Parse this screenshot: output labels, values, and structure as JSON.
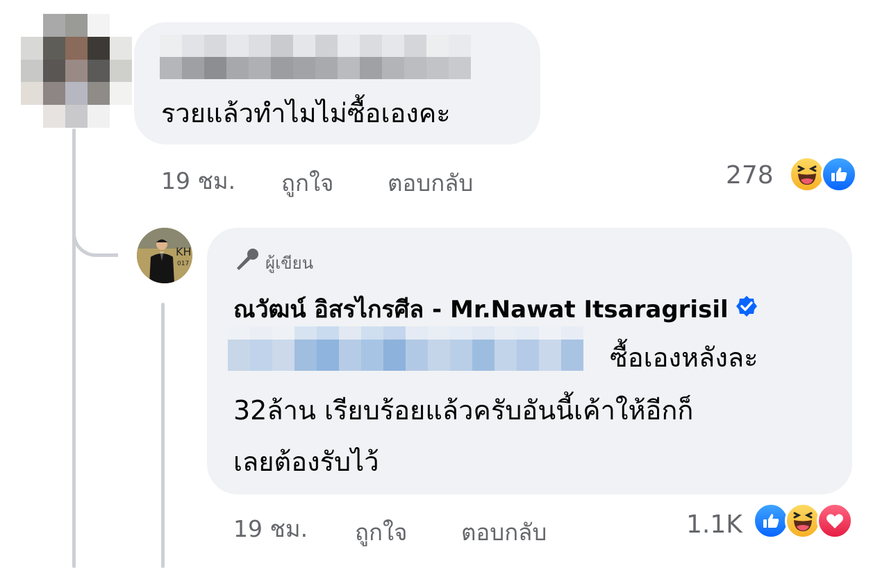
{
  "comment1": {
    "text": "รวยแล้วทำไมไม่ซื้อเองคะ",
    "time": "19 ชม.",
    "like_label": "ถูกใจ",
    "reply_label": "ตอบกลับ",
    "reaction_count": "278",
    "reactions": [
      "haha-icon",
      "like-icon"
    ]
  },
  "comment2": {
    "badge": "ผู้เขียน",
    "badge_icon": "microphone-icon",
    "author": "ณวัฒน์ อิสรไกรศีล - Mr.Nawat Itsaragrisil",
    "verified_icon": "verified-badge-icon",
    "text_line1": "ซื้อเองหลังละ",
    "text_line2": "32ล้าน เรียบร้อยแล้วครับอันนี้เค้าให้อีกก็",
    "text_line3": "เลยต้องรับไว้",
    "time": "19 ชม.",
    "like_label": "ถูกใจ",
    "reply_label": "ตอบกลับ",
    "reaction_count": "1.1K",
    "reactions": [
      "like-icon",
      "haha-icon",
      "love-icon"
    ]
  },
  "colors": {
    "bubble": "#f0f2f5",
    "meta_text": "#65676b",
    "like_blue": "#0866ff",
    "thread_line": "#ccd0d5"
  }
}
